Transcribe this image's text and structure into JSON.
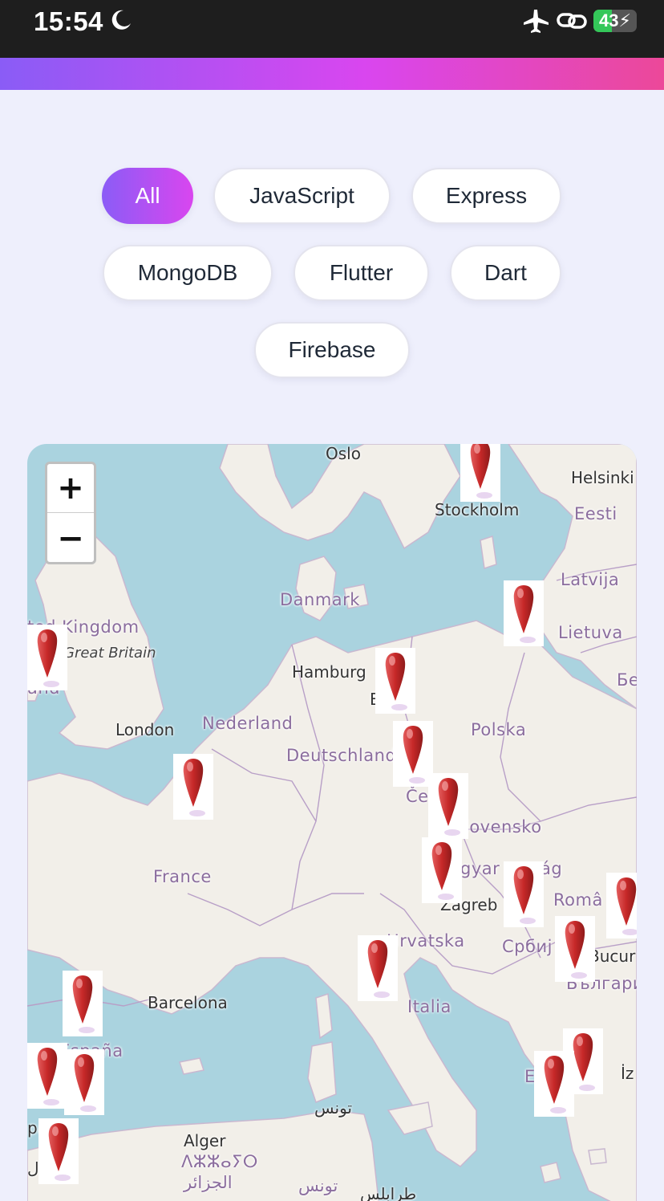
{
  "status_bar": {
    "time": "15:54",
    "battery": "43",
    "battery_level": 0.43
  },
  "filters": {
    "items": [
      "All",
      "JavaScript",
      "Express",
      "MongoDB",
      "Flutter",
      "Dart",
      "Firebase"
    ],
    "selected": "All"
  },
  "map": {
    "zoom_in": "+",
    "zoom_out": "−",
    "labels": {
      "oslo": "Oslo",
      "stockholm": "Stockholm",
      "helsinki": "Helsinki",
      "eesti": "Eesti",
      "latvija": "Latvija",
      "lietuva": "Lietuva",
      "danmark": "Danmark",
      "united_kingdom": "ted Kingdom",
      "great_britain": "Great Britain",
      "land": "and",
      "hamburg": "Hamburg",
      "be": "Бе",
      "berlin_fragment": "B",
      "london": "London",
      "nederland": "Nederland",
      "polska": "Polska",
      "deutschland": "Deutschland",
      "cesko": "Če",
      "slovensko": "lovensko",
      "magyar": "gyar",
      "mag": "ág",
      "france": "France",
      "zagreb": "Zagreb",
      "roma": "Româ",
      "hrvatska": "Hrvatska",
      "srbija": "Србиј",
      "bucur": "Bucur",
      "bulgaria": "Българи",
      "barcelona": "Barcelona",
      "italia": "Italia",
      "espana": "España",
      "iz": "İz",
      "e_frag": "E",
      "tunis_ar": "تونس",
      "alger": "Alger",
      "alger_tifinagh": "ⴷⵣⵣⴰⵢⵔ",
      "algeria_ar": "الجزائر",
      "tunisia_ar": "تونس",
      "tripoli_ar": "طرابلس",
      "pa": "pa",
      "ql": "ل"
    },
    "marker_count": 19
  }
}
